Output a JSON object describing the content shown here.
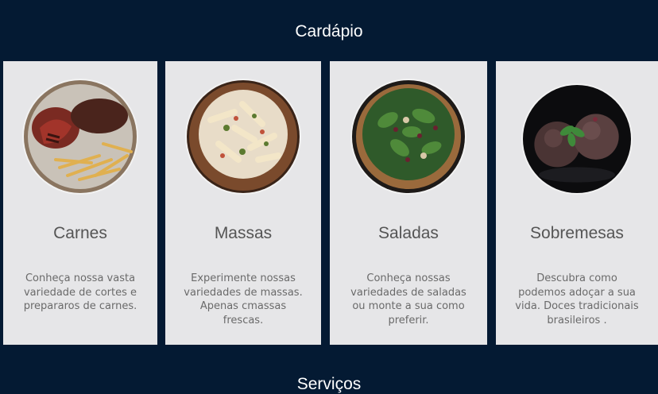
{
  "section": {
    "title": "Cardápio"
  },
  "next_section": {
    "title": "Serviços"
  },
  "cards": [
    {
      "name": "Carnes",
      "description": "Conheça nossa vasta variedade de cortes e prepararos de carnes.",
      "image": "steak-fries-photo"
    },
    {
      "name": "Massas",
      "description": "Experimente nossas variedades de massas. Apenas cmassas frescas.",
      "image": "penne-pasta-photo"
    },
    {
      "name": "Saladas",
      "description": "Conheça nossas variedades de saladas ou monte a sua como preferir.",
      "image": "green-salad-photo"
    },
    {
      "name": "Sobremesas",
      "description": "Descubra como podemos adoçar a sua vida. Doces tradicionais brasileiros .",
      "image": "chocolate-dessert-photo"
    }
  ]
}
